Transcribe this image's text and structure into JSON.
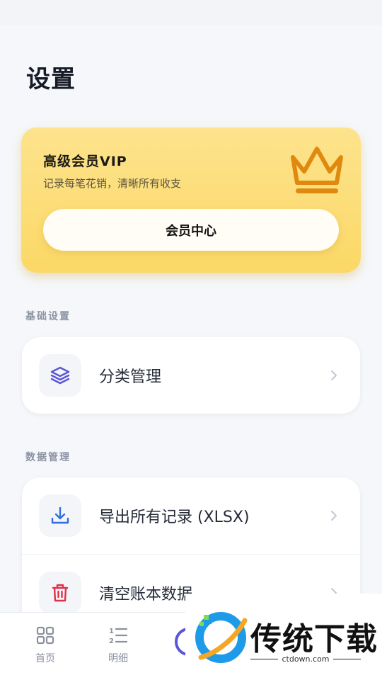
{
  "page": {
    "title": "设置"
  },
  "vip": {
    "title": "高级会员VIP",
    "subtitle": "记录每笔花销，清晰所有收支",
    "button_label": "会员中心",
    "icon": "crown-icon",
    "colors": {
      "card": "#fbd866",
      "crown": "#e0890f"
    }
  },
  "sections": {
    "basic": {
      "label": "基础设置",
      "items": [
        {
          "label": "分类管理",
          "icon": "layers-icon",
          "icon_color": "#5a55d9"
        }
      ]
    },
    "data": {
      "label": "数据管理",
      "items": [
        {
          "label": "导出所有记录 (XLSX)",
          "icon": "download-icon",
          "icon_color": "#2f6fe0"
        },
        {
          "label": "清空账本数据",
          "icon": "trash-icon",
          "icon_color": "#e0304a"
        }
      ]
    }
  },
  "tabbar": {
    "items": [
      {
        "label": "首页",
        "icon": "grid-icon"
      },
      {
        "label": "明细",
        "icon": "list-icon"
      }
    ],
    "accent": "#5a55d9"
  },
  "watermark": {
    "title": "传统下载",
    "url": "ctdown.com"
  }
}
